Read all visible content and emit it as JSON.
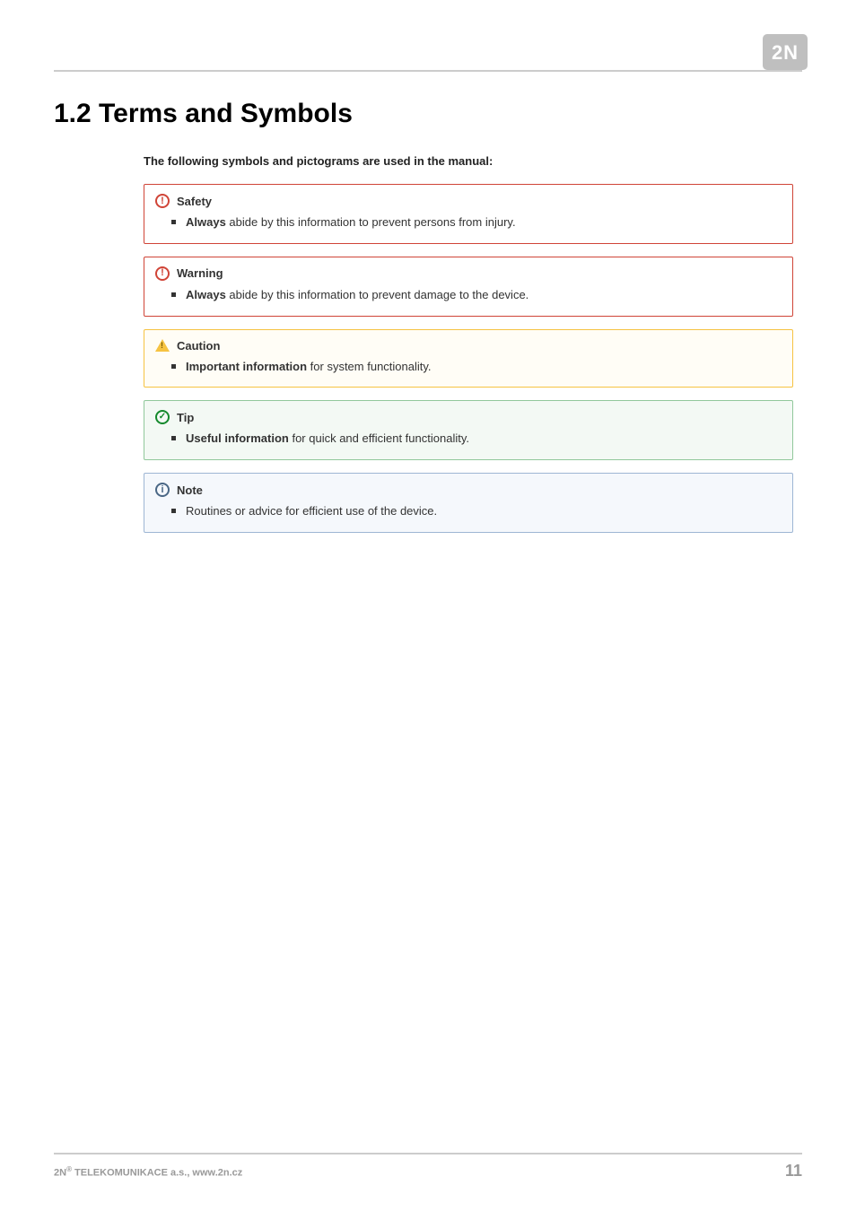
{
  "header": {
    "logo_text": "2N"
  },
  "title": "1.2 Terms and Symbols",
  "intro": "The following symbols and pictograms are used in the manual:",
  "callouts": {
    "safety": {
      "title": "Safety",
      "icon_glyph": "!",
      "bullet_bold": "Always",
      "bullet_rest": "  abide by this information to prevent persons from injury."
    },
    "warning": {
      "title": "Warning",
      "icon_glyph": "!",
      "bullet_bold": "Always",
      "bullet_rest": " abide by this information to prevent damage to the device."
    },
    "caution": {
      "title": "Caution",
      "bullet_bold": "Important information",
      "bullet_rest": " for system functionality."
    },
    "tip": {
      "title": "Tip",
      "bullet_bold": "Useful information",
      "bullet_rest": " for quick and efficient functionality."
    },
    "note": {
      "title": "Note",
      "icon_glyph": "i",
      "bullet_bold": "",
      "bullet_rest": "Routines or advice for efficient use of the device."
    }
  },
  "footer": {
    "left_prefix": "2N",
    "left_sup": "®",
    "left_rest": " TELEKOMUNIKACE a.s., www.2n.cz",
    "page_number": "11"
  }
}
